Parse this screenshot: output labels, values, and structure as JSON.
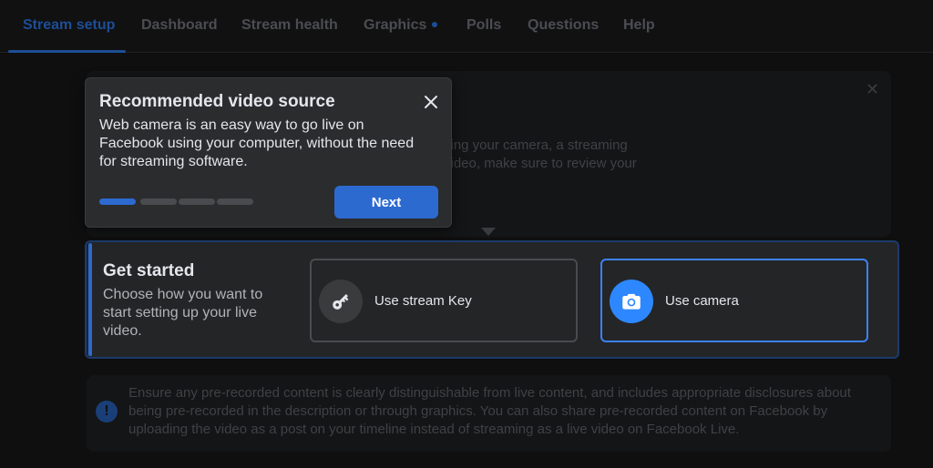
{
  "nav": {
    "tabs": [
      {
        "label": "Stream setup"
      },
      {
        "label": "Dashboard"
      },
      {
        "label": "Stream health"
      },
      {
        "label": "Graphics"
      },
      {
        "label": "Polls"
      },
      {
        "label": "Questions"
      },
      {
        "label": "Help"
      }
    ],
    "active_tab": "Stream setup"
  },
  "background": {
    "partial_text_line1": "sing your camera, a streaming",
    "partial_text_line2": "video, make sure to review your"
  },
  "popover": {
    "title": "Recommended video source",
    "body": "Web camera is an easy way to go live on Facebook using your computer, without the need for streaming software.",
    "next_label": "Next",
    "steps_total": 4,
    "current_step": 1
  },
  "get_started": {
    "title": "Get started",
    "description": "Choose how you want to start setting up your live video.",
    "options": [
      {
        "label": "Use stream Key",
        "icon": "key-icon",
        "selected": false
      },
      {
        "label": "Use camera",
        "icon": "camera-icon",
        "selected": true
      }
    ]
  },
  "notice": {
    "icon": "info-icon",
    "text": "Ensure any pre-recorded content is clearly distinguishable from live content, and includes appropriate disclosures about being pre-recorded in the description or through graphics. You can also share pre-recorded content on Facebook by uploading the video as a post on your timeline instead of streaming as a live video on Facebook Live."
  },
  "colors": {
    "accent": "#2d6ad0",
    "selected_border": "#3b82f6",
    "camera_icon_bg": "#2d88ff"
  }
}
